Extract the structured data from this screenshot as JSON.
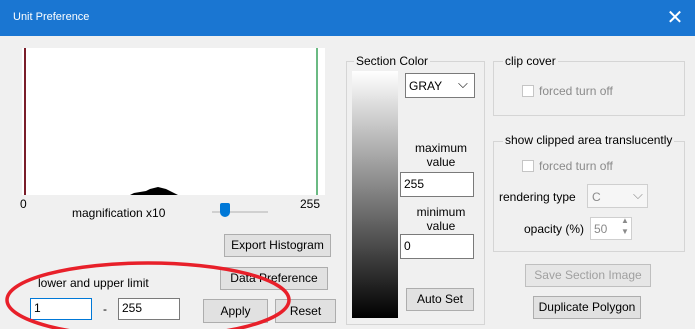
{
  "window": {
    "title": "Unit Preference",
    "close_glyph": "✕"
  },
  "histogram": {
    "axis_min": "0",
    "axis_max": "255",
    "magnification_label": "magnification x10",
    "magnification_level": 0.18
  },
  "buttons": {
    "export_histogram": "Export Histogram",
    "data_preference": "Data Preference",
    "apply": "Apply",
    "reset": "Reset",
    "auto_set": "Auto Set",
    "save_section_image": "Save Section Image",
    "duplicate_polygon": "Duplicate Polygon"
  },
  "limits": {
    "label": "lower and upper limit",
    "lower": "1",
    "separator": "-",
    "upper": "255"
  },
  "section_color": {
    "label": "Section Color",
    "color_value": "GRAY",
    "maximum_label_1": "maximum",
    "maximum_label_2": "value",
    "maximum_value": "255",
    "minimum_label_1": "minimum",
    "minimum_label_2": "value",
    "minimum_value": "0"
  },
  "clip_cover": {
    "label": "clip cover",
    "forced_turn_off": "forced turn off"
  },
  "clipped_area": {
    "label": "show clipped area translucently",
    "forced_turn_off": "forced turn off",
    "rendering_type_label": "rendering type",
    "rendering_type_value": "C",
    "opacity_label": "opacity (%)",
    "opacity_value": "50"
  },
  "colors": {
    "title_bar": "#1a76d2",
    "histogram_left_line": "#7a1e2a",
    "histogram_right_line": "#3aa35a",
    "slider_thumb": "#0078d7",
    "annotation_circle": "#e8202a"
  }
}
